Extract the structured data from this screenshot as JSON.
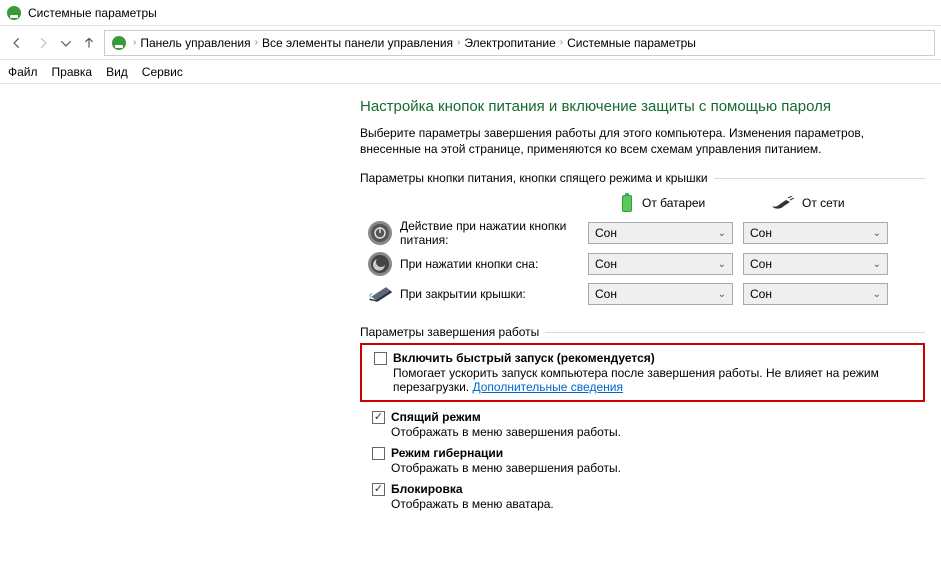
{
  "title": "Системные параметры",
  "breadcrumb": {
    "items": [
      "Панель управления",
      "Все элементы панели управления",
      "Электропитание",
      "Системные параметры"
    ]
  },
  "menu": {
    "items": [
      "Файл",
      "Правка",
      "Вид",
      "Сервис"
    ]
  },
  "heading": "Настройка кнопок питания и включение защиты с помощью пароля",
  "description": "Выберите параметры завершения работы для этого компьютера. Изменения параметров, внесенные на этой странице, применяются ко всем схемам управления питанием.",
  "section1": {
    "title": "Параметры кнопки питания, кнопки спящего режима и крышки",
    "col_battery": "От батареи",
    "col_ac": "От сети",
    "rows": [
      {
        "label": "Действие при нажатии кнопки питания:",
        "battery": "Сон",
        "ac": "Сон"
      },
      {
        "label": "При нажатии кнопки сна:",
        "battery": "Сон",
        "ac": "Сон"
      },
      {
        "label": "При закрытии крышки:",
        "battery": "Сон",
        "ac": "Сон"
      }
    ]
  },
  "section2": {
    "title": "Параметры завершения работы",
    "options": [
      {
        "label": "Включить быстрый запуск (рекомендуется)",
        "checked": false,
        "desc_pre": "Помогает ускорить запуск компьютера после завершения работы. Не влияет на режим перезагрузки. ",
        "link": "Дополнительные сведения"
      },
      {
        "label": "Спящий режим",
        "checked": true,
        "desc": "Отображать в меню завершения работы."
      },
      {
        "label": "Режим гибернации",
        "checked": false,
        "desc": "Отображать в меню завершения работы."
      },
      {
        "label": "Блокировка",
        "checked": true,
        "desc": "Отображать в меню аватара."
      }
    ]
  }
}
